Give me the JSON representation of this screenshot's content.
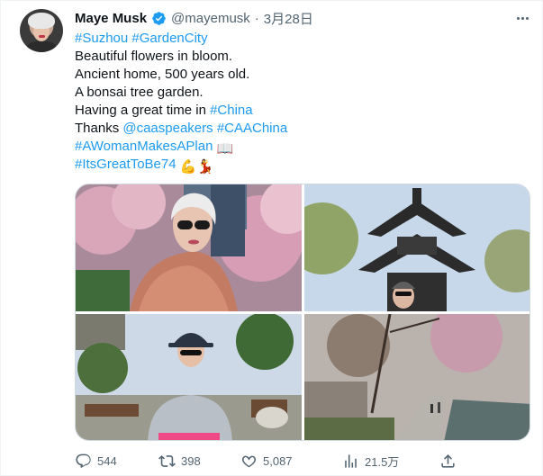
{
  "tweet": {
    "author_name": "Maye Musk",
    "handle": "@mayemusk",
    "separator": "·",
    "date": "3月28日",
    "lines": [
      [
        {
          "t": "#Suzhou",
          "link": true
        },
        {
          "t": " ",
          "link": false
        },
        {
          "t": "#GardenCity",
          "link": true
        }
      ],
      [
        {
          "t": "Beautiful flowers in bloom.",
          "link": false
        }
      ],
      [
        {
          "t": "Ancient home, 500 years old.",
          "link": false
        }
      ],
      [
        {
          "t": "A bonsai tree garden.",
          "link": false
        }
      ],
      [
        {
          "t": "Having a great time in ",
          "link": false
        },
        {
          "t": "#China",
          "link": true
        }
      ],
      [
        {
          "t": "Thanks ",
          "link": false
        },
        {
          "t": "@caaspeakers",
          "link": true
        },
        {
          "t": " ",
          "link": false
        },
        {
          "t": "#CAAChina",
          "link": true
        }
      ],
      [
        {
          "t": "#AWomanMakesAPlan",
          "link": true
        },
        {
          "t": " ",
          "link": false
        },
        {
          "t": "📖",
          "link": false,
          "emoji": "book-emoji"
        }
      ],
      [
        {
          "t": "#ItsGreatToBe74",
          "link": true
        },
        {
          "t": " ",
          "link": false
        },
        {
          "t": "💪",
          "link": false,
          "emoji": "flexed-biceps-emoji"
        },
        {
          "t": "💃",
          "link": false,
          "emoji": "dancer-emoji"
        }
      ]
    ]
  },
  "media": [
    {
      "name": "photo-pink-coat-blossoms",
      "icon": "woman-in-pink-coat-under-blossoms"
    },
    {
      "name": "photo-pagoda-pavilion",
      "icon": "chinese-pavilion-with-visitor"
    },
    {
      "name": "photo-bonsai-garden",
      "icon": "woman-in-bonsai-garden"
    },
    {
      "name": "photo-canal-path",
      "icon": "garden-path-by-canal"
    }
  ],
  "actions": {
    "reply": {
      "icon": "reply-icon",
      "count": "544"
    },
    "retweet": {
      "icon": "retweet-icon",
      "count": "398"
    },
    "like": {
      "icon": "heart-icon",
      "count": "5,087"
    },
    "views": {
      "icon": "views-chart-icon",
      "count": "21.5万"
    },
    "share": {
      "icon": "share-icon"
    }
  },
  "colors": {
    "link": "#1d9bf0",
    "muted": "#536471",
    "text": "#0f1419",
    "verified": "#1d9bf0"
  }
}
